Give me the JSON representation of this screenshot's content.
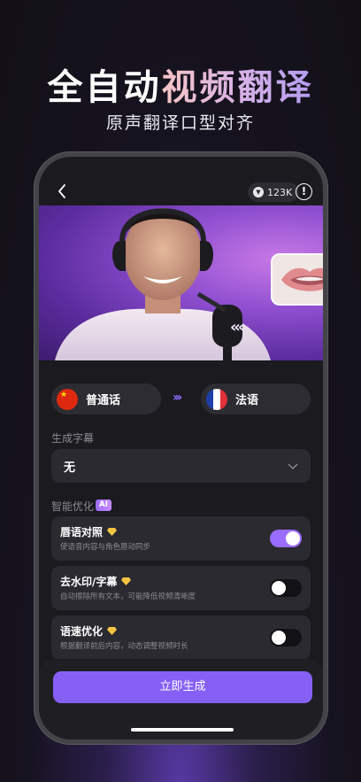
{
  "hero": {
    "title_plain": "全自动",
    "title_accent": "视频翻译",
    "subtitle": "原声翻译口型对齐"
  },
  "topbar": {
    "back_icon": "chevron-left-icon",
    "credits_value": "123K",
    "info_icon": "info-icon"
  },
  "languages": {
    "source": "普通话",
    "target": "法语",
    "source_flag": "china-flag-icon",
    "target_flag": "france-flag-icon"
  },
  "subtitle_section": {
    "label": "生成字幕",
    "selected": "无"
  },
  "smart_section": {
    "label": "智能优化",
    "badge": "AI"
  },
  "options": [
    {
      "title": "唇语对照",
      "desc": "使语音内容与角色唇动同步",
      "enabled": true
    },
    {
      "title": "去水印/字幕",
      "desc": "自动擦除所有文本，可能降低视频清晰度",
      "enabled": false
    },
    {
      "title": "语速优化",
      "desc": "根据翻译前后内容，动态调整视频时长",
      "enabled": false
    }
  ],
  "action": {
    "generate_label": "立即生成"
  },
  "colors": {
    "accent": "#8660f6",
    "toggle_on": "#9a6cff",
    "card_bg": "#2a2a30",
    "gem": "#f5c542"
  }
}
